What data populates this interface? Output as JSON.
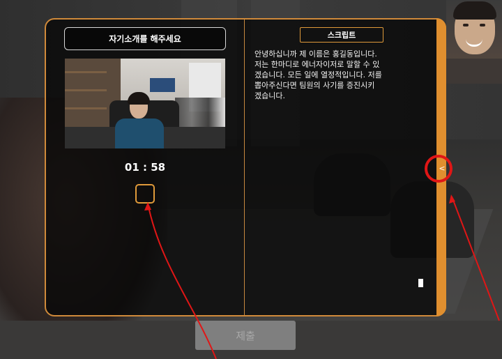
{
  "left": {
    "title": "자기소개를 해주세요",
    "timer": "01 : 58"
  },
  "right": {
    "script_label": "스크립트",
    "script_text": "안녕하십니까 제 이름은 홍길동입니다.\n저는 한마디로 에너자이저로 말할 수 있\n겠습니다. 모든 일에 열정적입니다. 저를\n뽑아주신다면 팀원의 사기를 증진시키\n겠습니다."
  },
  "panel": {
    "collapse_glyph": "<"
  },
  "footer": {
    "submit_label": "제출"
  },
  "colors": {
    "accent": "#e08f2f",
    "annotation": "#e01616"
  },
  "icons": {
    "record": "record-square-icon",
    "collapse": "chevron-left-icon"
  }
}
